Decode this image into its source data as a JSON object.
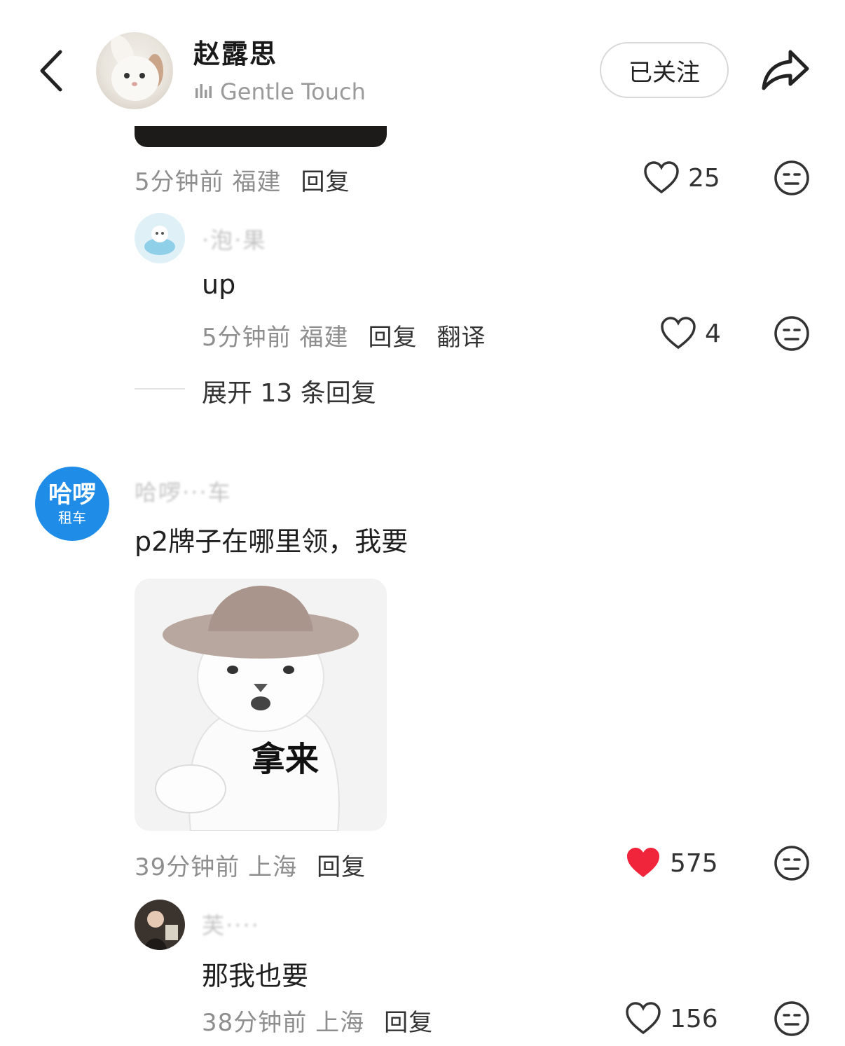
{
  "header": {
    "author_name": "赵露思",
    "music": "Gentle Touch",
    "follow_label": "已关注"
  },
  "comments": [
    {
      "time_location": "5分钟前 福建",
      "reply_label": "回复",
      "likes": "25"
    },
    {
      "username": "‧泡‧果",
      "text": "up",
      "time_location": "5分钟前 福建",
      "reply_label": "回复",
      "translate_label": "翻译",
      "likes": "4"
    },
    {
      "expand_label": "展开 13 条回复"
    },
    {
      "avatar_line1": "哈啰",
      "avatar_line2": "租车",
      "username": "哈啰‧‧‧车",
      "text": "p2牌子在哪里领，我要",
      "sticker_caption": "拿来",
      "time_location": "39分钟前 上海",
      "reply_label": "回复",
      "likes": "575",
      "liked": true
    },
    {
      "username": "芙‧‧‧‧",
      "text": "那我也要",
      "time_location": "38分钟前 上海",
      "reply_label": "回复",
      "likes": "156"
    }
  ],
  "colors": {
    "liked_heart": "#f0243b",
    "brand_blue": "#1f8de8",
    "muted_text": "#8e8e8e"
  }
}
